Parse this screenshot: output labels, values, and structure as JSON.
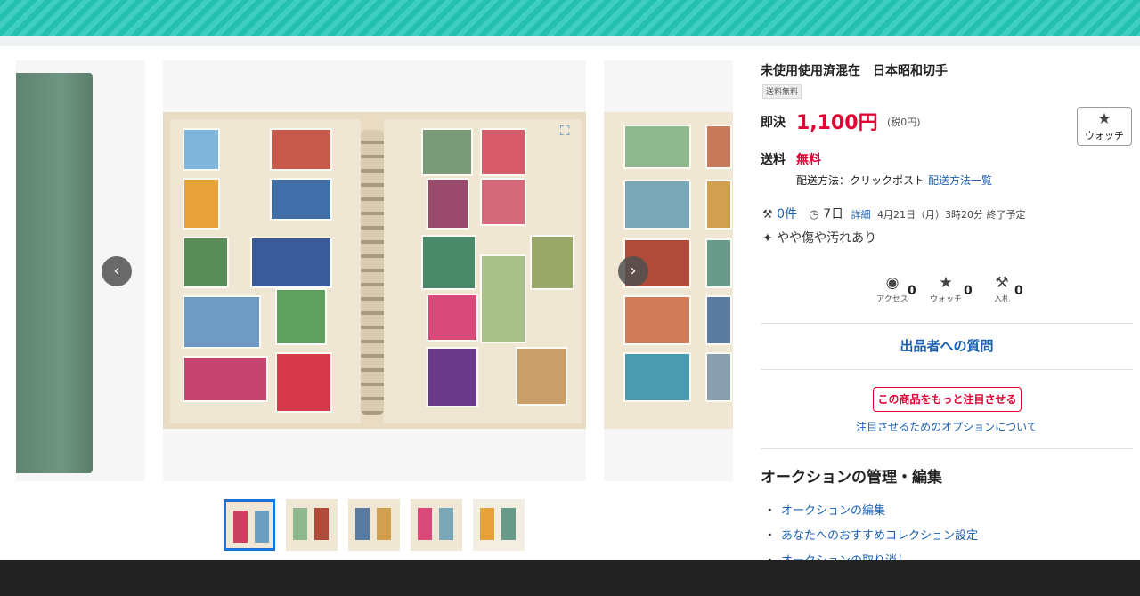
{
  "item": {
    "title": "未使用使用済混在　日本昭和切手",
    "badge": "送料無料"
  },
  "price": {
    "label": "即決",
    "value": "1,100円",
    "tax": "(税0円)"
  },
  "watch_button": {
    "icon": "star-icon",
    "label": "ウォッチ"
  },
  "shipping": {
    "label": "送料",
    "value": "無料",
    "method": "配送方法：クリックポスト",
    "method_link": "配送方法一覧"
  },
  "auction_meta": {
    "bids": "0件",
    "duration": "7日",
    "detail_link": "詳細",
    "end_time": "4月21日（月）3時20分 終了予定"
  },
  "condition": "やや傷や汚れあり",
  "stats": [
    {
      "icon": "eye-icon",
      "caption": "アクセス",
      "count": "0"
    },
    {
      "icon": "star-icon",
      "caption": "ウォッチ",
      "count": "0"
    },
    {
      "icon": "gavel-icon",
      "caption": "入札",
      "count": "0"
    }
  ],
  "seller_question": "出品者への質問",
  "promote": {
    "button": "この商品をもっと注目させる",
    "link": "注目させるためのオプションについて"
  },
  "manage": {
    "title": "オークションの管理・編集",
    "items": [
      "オークションの編集",
      "あなたへのおすすめコレクション設定",
      "オークションの取り消し"
    ]
  },
  "gallery": {
    "prev_icon": "chevron-left-icon",
    "next_icon": "chevron-right-icon",
    "zoom_icon": "zoom-icon",
    "thumbnail_count": 5,
    "active_thumbnail": 1
  },
  "colors": {
    "price_red": "#e00033",
    "link_blue": "#1a5fb4",
    "header_teal": "#23c0b0"
  }
}
